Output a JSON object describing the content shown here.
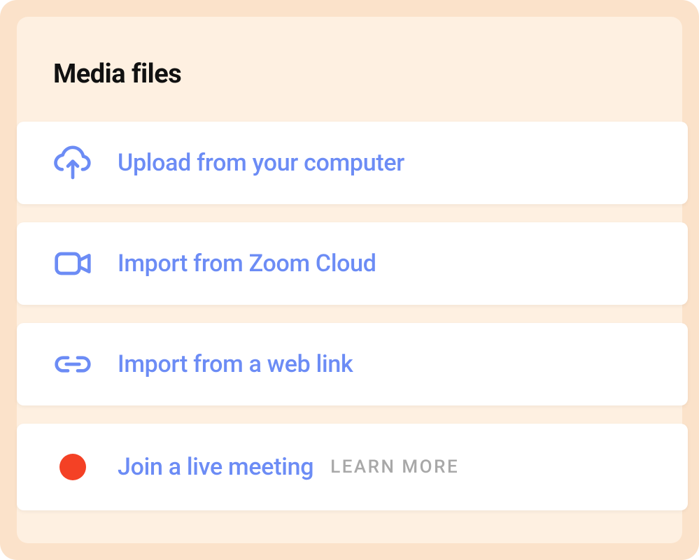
{
  "section": {
    "title": "Media files"
  },
  "options": {
    "upload": {
      "label": "Upload from your computer",
      "icon": "cloud-upload-icon"
    },
    "zoom": {
      "label": "Import from Zoom Cloud",
      "icon": "video-camera-icon"
    },
    "weblink": {
      "label": "Import from a web link",
      "icon": "link-icon"
    },
    "live": {
      "label": "Join a live meeting",
      "secondary": "LEARN MORE",
      "icon": "record-dot-icon"
    }
  },
  "colors": {
    "accent": "#6C8CF5",
    "record": "#F44125",
    "outerBg": "#FBE2CA",
    "innerBg": "#FEF0E1"
  }
}
